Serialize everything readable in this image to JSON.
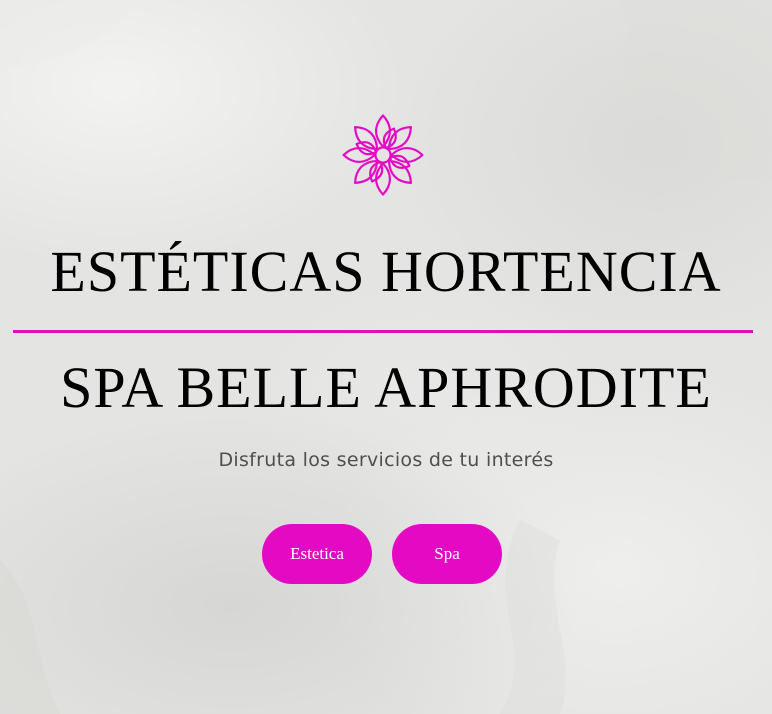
{
  "brand": {
    "logo_icon": "lotus-flower-icon",
    "accent_color": "#e40ac4"
  },
  "hero": {
    "title": "ESTÉTICAS HORTENCIA",
    "subtitle": "SPA BELLE APHRODITE",
    "tagline": "Disfruta los servicios de tu interés"
  },
  "buttons": {
    "estetica_label": "Estetica",
    "spa_label": "Spa"
  }
}
